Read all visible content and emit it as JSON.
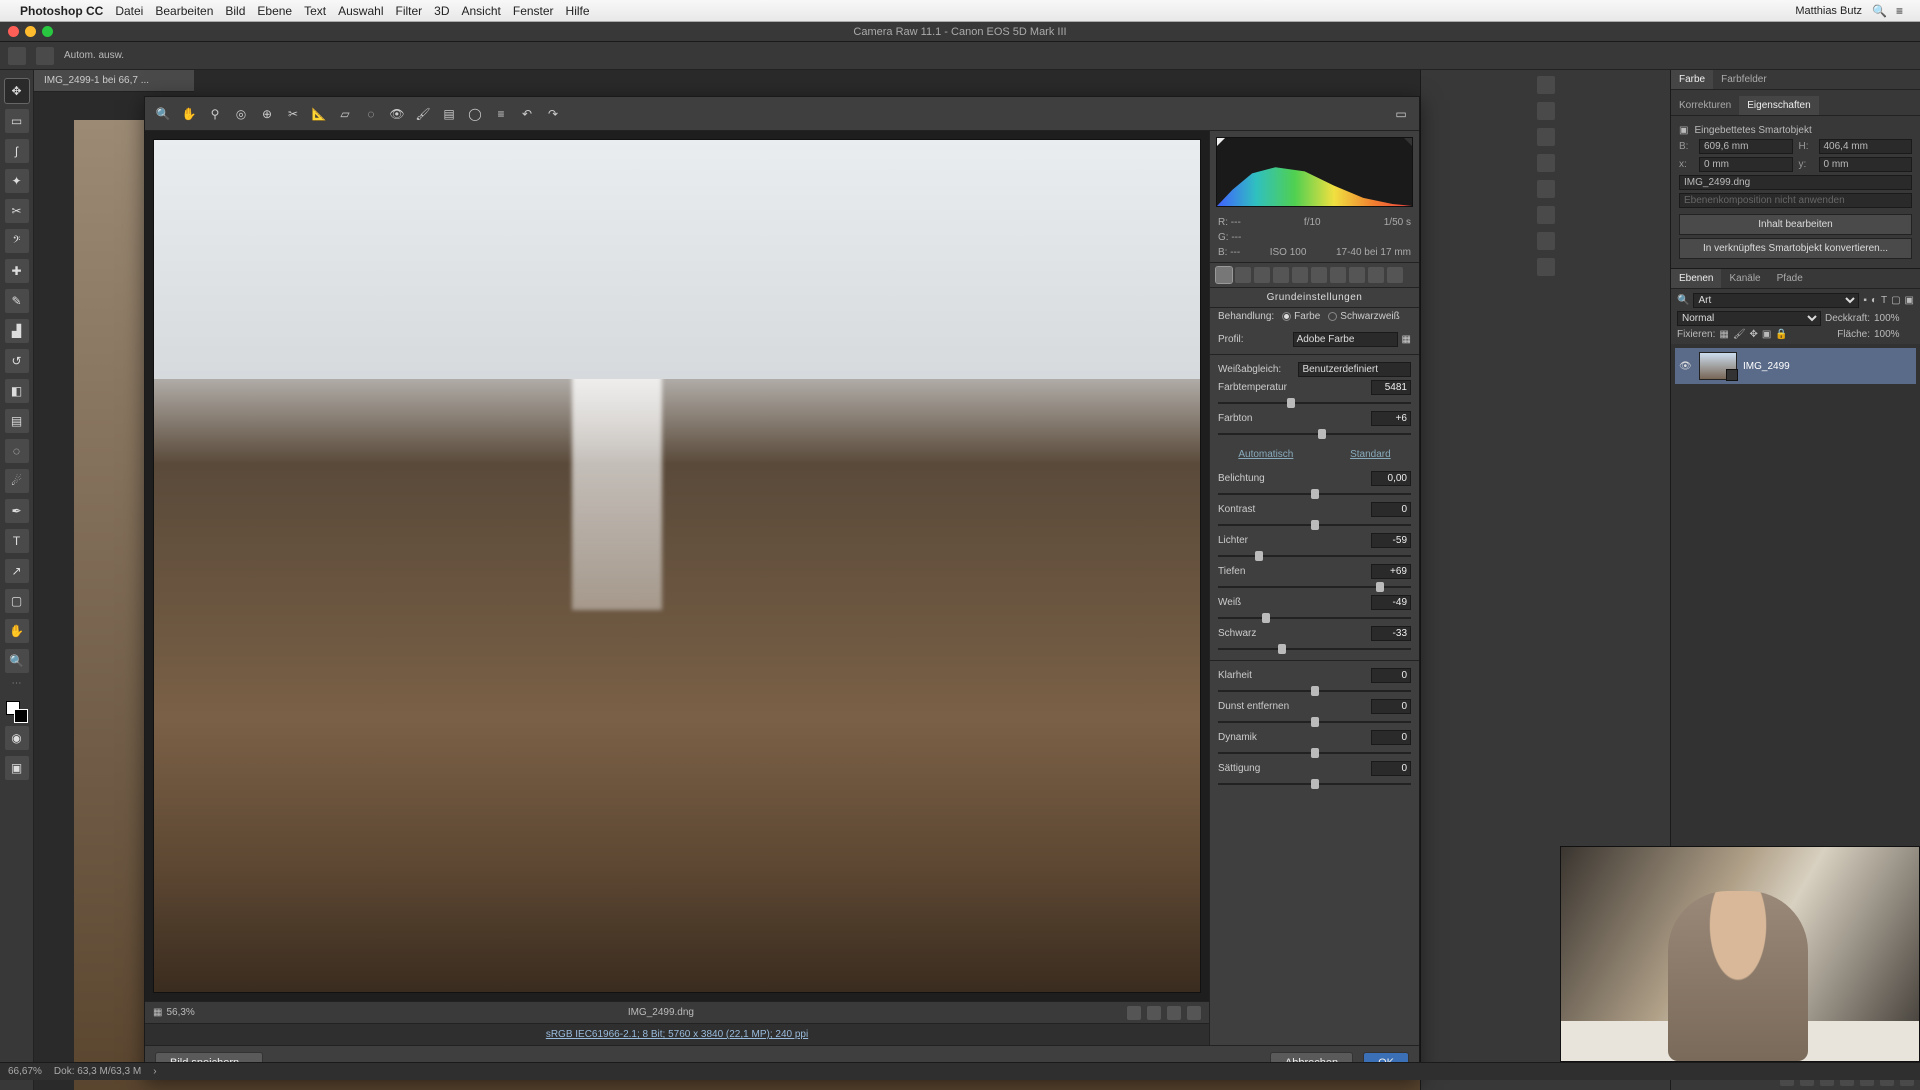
{
  "menubar": {
    "app": "Photoshop CC",
    "items": [
      "Datei",
      "Bearbeiten",
      "Bild",
      "Ebene",
      "Text",
      "Auswahl",
      "Filter",
      "3D",
      "Ansicht",
      "Fenster",
      "Hilfe"
    ],
    "user": "Matthias Butz"
  },
  "window": {
    "title": "Camera Raw 11.1  -  Canon EOS 5D Mark III"
  },
  "options_bar": {
    "label": "Autom. ausw."
  },
  "doc_tab": "IMG_2499-1 bei 66,7 ...",
  "camera_raw": {
    "meta": {
      "r": "R:  ---",
      "g": "G:  ---",
      "b": "B:  ---",
      "aperture": "f/10",
      "shutter": "1/50 s",
      "iso": "ISO 100",
      "lens": "17-40 bei 17 mm"
    },
    "panel_title": "Grundeinstellungen",
    "treatment": {
      "label": "Behandlung:",
      "color": "Farbe",
      "bw": "Schwarzweiß"
    },
    "profile": {
      "label": "Profil:",
      "value": "Adobe Farbe"
    },
    "wb": {
      "label": "Weißabgleich:",
      "value": "Benutzerdefiniert"
    },
    "sliders": {
      "temp": {
        "label": "Farbtemperatur",
        "value": "5481",
        "pos": 38
      },
      "tint": {
        "label": "Farbton",
        "value": "+6",
        "pos": 54
      },
      "auto": "Automatisch",
      "default": "Standard",
      "exposure": {
        "label": "Belichtung",
        "value": "0,00",
        "pos": 50
      },
      "contrast": {
        "label": "Kontrast",
        "value": "0",
        "pos": 50
      },
      "highlights": {
        "label": "Lichter",
        "value": "-59",
        "pos": 21
      },
      "shadows": {
        "label": "Tiefen",
        "value": "+69",
        "pos": 84
      },
      "whites": {
        "label": "Weiß",
        "value": "-49",
        "pos": 25
      },
      "blacks": {
        "label": "Schwarz",
        "value": "-33",
        "pos": 33
      },
      "clarity": {
        "label": "Klarheit",
        "value": "0",
        "pos": 50
      },
      "dehaze": {
        "label": "Dunst entfernen",
        "value": "0",
        "pos": 50
      },
      "vibrance": {
        "label": "Dynamik",
        "value": "0",
        "pos": 50
      },
      "saturation": {
        "label": "Sättigung",
        "value": "0",
        "pos": 50
      }
    },
    "zoom": "56,3%",
    "filename": "IMG_2499.dng",
    "color_profile": "sRGB IEC61966-2.1; 8 Bit; 5760 x 3840 (22,1 MP); 240 ppi",
    "buttons": {
      "save": "Bild speichern...",
      "cancel": "Abbrechen",
      "ok": "OK"
    }
  },
  "ps_panels": {
    "color_tab": "Farbe",
    "swatches_tab": "Farbfelder",
    "corrections_tab": "Korrekturen",
    "properties_tab": "Eigenschaften",
    "smartobj": "Eingebettetes Smartobjekt",
    "dims": {
      "w_label": "B:",
      "w": "609,6 mm",
      "h_label": "H:",
      "h": "406,4 mm",
      "x_label": "x:",
      "x": "0 mm",
      "y_label": "y:",
      "y": "0 mm"
    },
    "source": "IMG_2499.dng",
    "layercomp_placeholder": "Ebenenkomposition nicht anwenden",
    "edit_btn": "Inhalt bearbeiten",
    "convert_btn": "In verknüpftes Smartobjekt konvertieren...",
    "layers_tab": "Ebenen",
    "channels_tab": "Kanäle",
    "paths_tab": "Pfade",
    "search_placeholder": "Art",
    "blend": "Normal",
    "opacity_label": "Deckkraft:",
    "opacity": "100%",
    "lock_label": "Fixieren:",
    "fill_label": "Fläche:",
    "fill": "100%",
    "layer_name": "IMG_2499"
  },
  "statusbar": {
    "zoom": "66,67%",
    "docsize": "Dok: 63,3 M/63,3 M"
  }
}
